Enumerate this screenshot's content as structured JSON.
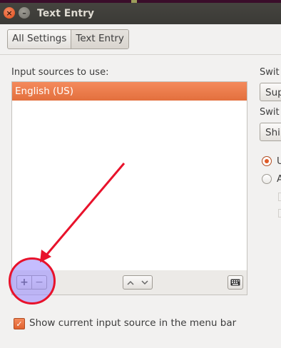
{
  "window": {
    "title": "Text Entry"
  },
  "breadcrumb": {
    "items": [
      "All Settings",
      "Text Entry"
    ]
  },
  "input_sources": {
    "label": "Input sources to use:",
    "items": [
      {
        "label": "English (US)",
        "selected": true
      }
    ]
  },
  "list_toolbar": {
    "add_icon": "plus-icon",
    "remove_icon": "minus-icon",
    "move_up_icon": "chevron-up-icon",
    "move_down_icon": "chevron-down-icon",
    "keyboard_icon": "keyboard-icon"
  },
  "right_panel": {
    "switch_label_1": "Swit",
    "switch_value_1": "Sup",
    "switch_label_2": "Swit",
    "switch_value_2": "Shi",
    "radio_1_label": "U",
    "radio_2_label": "A"
  },
  "show_source": {
    "label": "Show current input source in the menu bar",
    "checked": true
  },
  "colors": {
    "accent": "#e36f3d",
    "annotation_arrow": "#e8122b",
    "highlight_fill": "#9687ff"
  }
}
